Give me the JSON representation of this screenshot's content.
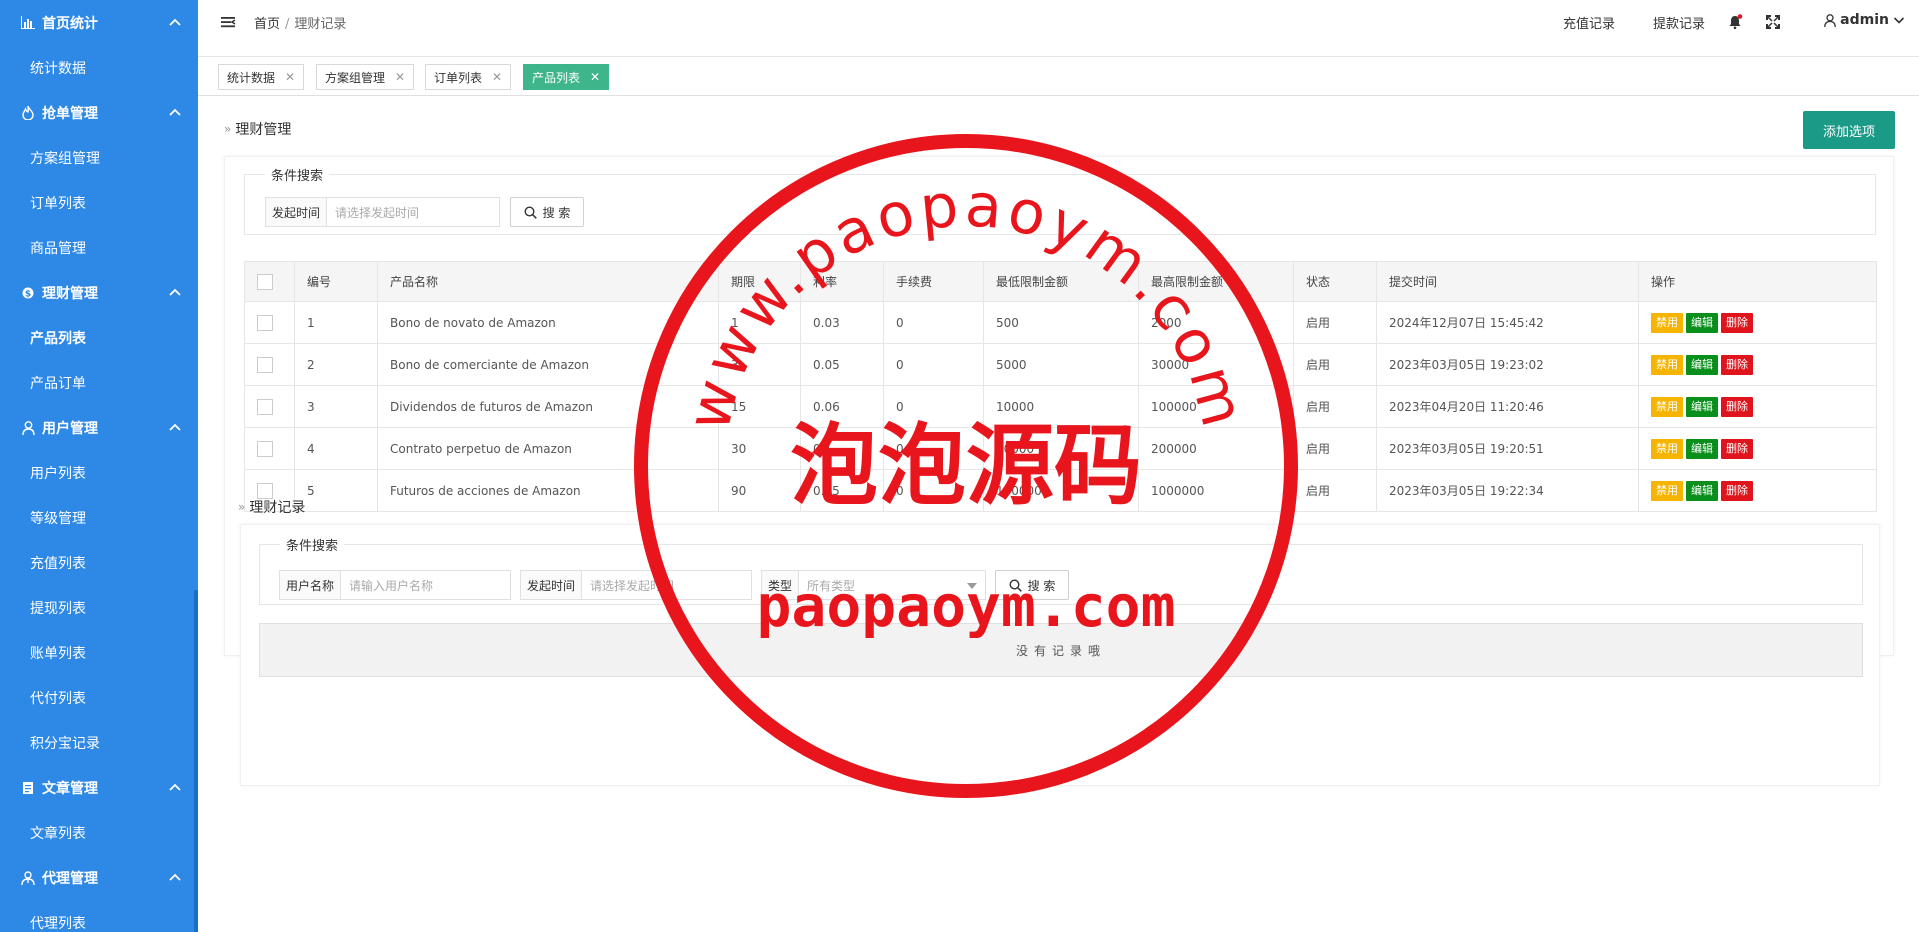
{
  "sidebar": {
    "groups": [
      {
        "label": "首页统计",
        "icon": "chart-icon",
        "items": [
          "统计数据"
        ]
      },
      {
        "label": "抢单管理",
        "icon": "fire-icon",
        "items": [
          "方案组管理",
          "订单列表",
          "商品管理"
        ]
      },
      {
        "label": "理财管理",
        "icon": "coin-icon",
        "items": [
          "产品列表",
          "产品订单"
        ]
      },
      {
        "label": "用户管理",
        "icon": "user-icon",
        "items": [
          "用户列表",
          "等级管理",
          "充值列表",
          "提现列表",
          "账单列表",
          "代付列表",
          "积分宝记录"
        ]
      },
      {
        "label": "文章管理",
        "icon": "document-icon",
        "items": [
          "文章列表"
        ]
      },
      {
        "label": "代理管理",
        "icon": "agent-icon",
        "items": [
          "代理列表"
        ]
      }
    ],
    "active_item": "产品列表"
  },
  "topbar": {
    "breadcrumb_home": "首页",
    "breadcrumb_sep": "/",
    "breadcrumb_current": "理财记录",
    "recharge_link": "充值记录",
    "withdraw_link": "提款记录",
    "username": "admin"
  },
  "tabs": [
    {
      "label": "统计数据",
      "active": false
    },
    {
      "label": "方案组管理",
      "active": false
    },
    {
      "label": "订单列表",
      "active": false
    },
    {
      "label": "产品列表",
      "active": true
    }
  ],
  "wealth": {
    "title": "理财管理",
    "add_button": "添加选项",
    "search_legend": "条件搜索",
    "time_label": "发起时间",
    "time_placeholder": "请选择发起时间",
    "search_button": "搜 索",
    "columns": [
      "编号",
      "产品名称",
      "期限",
      "利率",
      "手续费",
      "最低限制金额",
      "最高限制金额",
      "状态",
      "提交时间",
      "操作"
    ],
    "rows": [
      {
        "id": "1",
        "name": "Bono de novato de Amazon",
        "term": "1",
        "rate": "0.03",
        "fee": "0",
        "min": "500",
        "max": "2000",
        "status": "启用",
        "time": "2024年12月07日 15:45:42"
      },
      {
        "id": "2",
        "name": "Bono de comerciante de Amazon",
        "term": "3",
        "rate": "0.05",
        "fee": "0",
        "min": "5000",
        "max": "30000",
        "status": "启用",
        "time": "2023年03月05日 19:23:02"
      },
      {
        "id": "3",
        "name": "Dividendos de futuros de Amazon",
        "term": "15",
        "rate": "0.06",
        "fee": "0",
        "min": "10000",
        "max": "100000",
        "status": "启用",
        "time": "2023年04月20日 11:20:46"
      },
      {
        "id": "4",
        "name": "Contrato perpetuo de Amazon",
        "term": "30",
        "rate": "0.1",
        "fee": "0",
        "min": "50000",
        "max": "200000",
        "status": "启用",
        "time": "2023年03月05日 19:20:51"
      },
      {
        "id": "5",
        "name": "Futuros de acciones de Amazon",
        "term": "90",
        "rate": "0.15",
        "fee": "0",
        "min": "100000",
        "max": "1000000",
        "status": "启用",
        "time": "2023年03月05日 19:22:34"
      }
    ],
    "op_disable": "禁用",
    "op_edit": "编辑",
    "op_delete": "删除",
    "page_html": "think_library_page_html"
  },
  "records": {
    "title": "理财记录",
    "search_legend": "条件搜索",
    "user_label": "用户名称",
    "user_placeholder": "请输入用户名称",
    "time_label": "发起时间",
    "time_placeholder": "请选择发起时间",
    "type_label": "类型",
    "type_value": "所有类型",
    "search_button": "搜 索",
    "empty_text": "没有记录哦"
  },
  "watermark": {
    "arc_text": "www.paopaoym.com",
    "center_text": "泡泡源码",
    "bottom_text": "paopaoym.com",
    "color": "#e8151c"
  },
  "colors": {
    "sidebar": "#2e89e6",
    "accent": "#1a9a87",
    "tab_active": "#3fb58b"
  }
}
